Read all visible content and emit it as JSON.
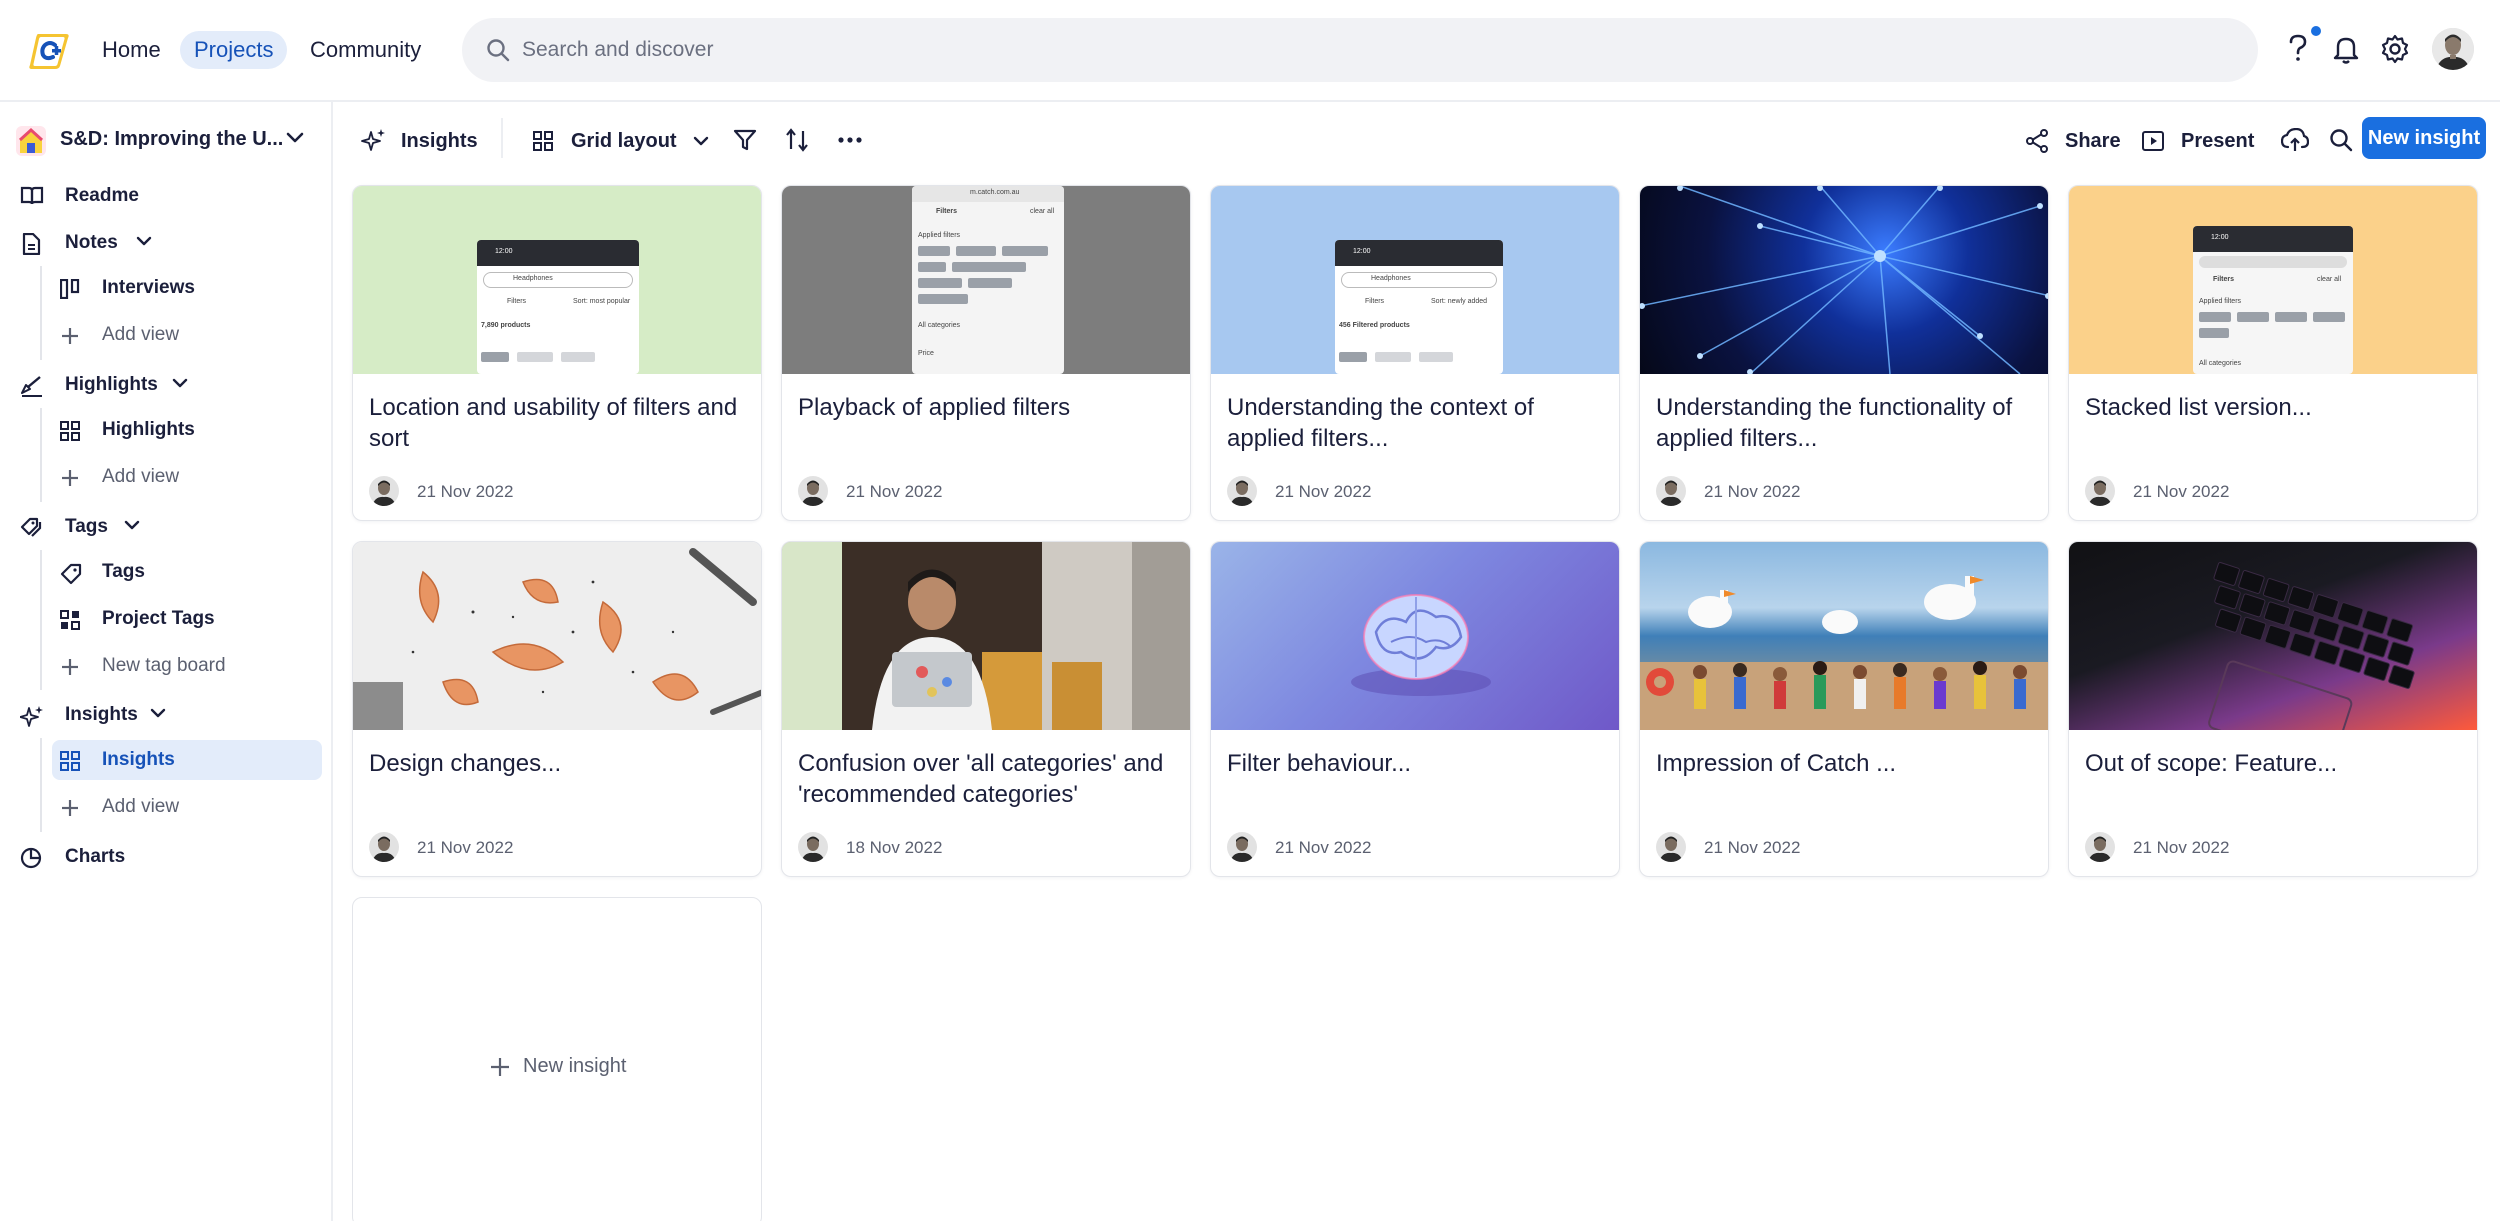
{
  "topbar": {
    "nav": [
      {
        "label": "Home",
        "active": false
      },
      {
        "label": "Projects",
        "active": true
      },
      {
        "label": "Community",
        "active": false
      }
    ],
    "search_placeholder": "Search and discover",
    "icons": [
      "help-icon",
      "bell-icon",
      "gear-icon"
    ]
  },
  "sidebar": {
    "project_name": "S&D: Improving the U...",
    "readme": "Readme",
    "notes": {
      "label": "Notes",
      "items": [
        "Interviews",
        "Add view"
      ]
    },
    "highlights": {
      "label": "Highlights",
      "items": [
        "Highlights",
        "Add view"
      ]
    },
    "tags": {
      "label": "Tags",
      "items": [
        "Tags",
        "Project Tags",
        "New tag board"
      ]
    },
    "insights": {
      "label": "Insights",
      "items": [
        "Insights",
        "Add view"
      ]
    },
    "charts": "Charts"
  },
  "toolbar": {
    "insights": "Insights",
    "layout": "Grid layout",
    "share": "Share",
    "present": "Present",
    "new_insight": "New insight"
  },
  "cards": [
    {
      "title": "Location and usability of filters and sort",
      "date": "21 Nov 2022",
      "thumb_bg": "#d6ecc6"
    },
    {
      "title": "Playback of applied filters",
      "date": "21 Nov 2022",
      "thumb_bg": "#7d7d7d"
    },
    {
      "title": "Understanding the context of applied filters...",
      "date": "21 Nov 2022",
      "thumb_bg": "#a7c8f0"
    },
    {
      "title": "Understanding the functionality of applied filters...",
      "date": "21 Nov 2022",
      "thumb_bg": "#0b1440"
    },
    {
      "title": "Stacked list version...",
      "date": "21 Nov 2022",
      "thumb_bg": "#fbd18a"
    },
    {
      "title": "Design changes...",
      "date": "21 Nov 2022",
      "thumb_bg": "#eeeeee"
    },
    {
      "title": "Confusion over 'all categories' and 'recommended categories'",
      "date": "18 Nov 2022",
      "thumb_bg": "#b9b5ae"
    },
    {
      "title": "Filter behaviour...",
      "date": "21 Nov 2022",
      "thumb_bg": "#7e88e0"
    },
    {
      "title": "Impression of Catch ...",
      "date": "21 Nov 2022",
      "thumb_bg": "#8bb8e0"
    },
    {
      "title": "Out of scope: Feature...",
      "date": "21 Nov 2022",
      "thumb_bg": "#1a1a1e"
    }
  ],
  "new_insight_card": "New insight",
  "mockup_text": {
    "time": "12:00",
    "search_value": "Headphones",
    "filters": "Filters",
    "sort": "Sort: most popular",
    "sort_alt": "Sort: newly added",
    "products": "7,890 products",
    "filtered_products": "456 Filtered products",
    "applied_filters": "Applied filters",
    "clear_all": "clear all",
    "all_categories": "All categories",
    "price": "Price",
    "url": "m.catch.com.au"
  },
  "colors": {
    "accent": "#1a6fe0",
    "active_bg": "#e3ecfa",
    "active_text": "#1652b8"
  }
}
